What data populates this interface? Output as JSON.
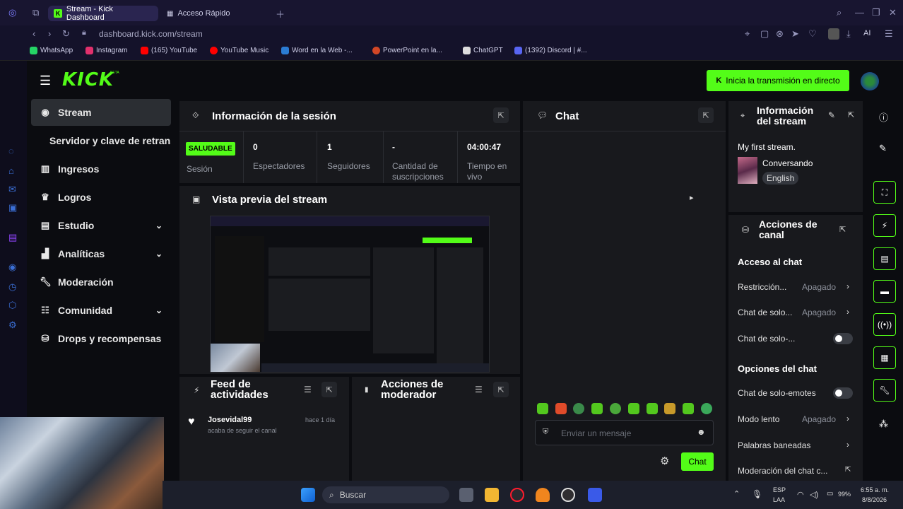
{
  "browser": {
    "tabs": [
      {
        "label": "Stream - Kick Dashboard"
      },
      {
        "label": "Acceso Rápido"
      }
    ],
    "url": "dashboard.kick.com/stream",
    "ai_label": "AI",
    "bookmarks": [
      {
        "label": "WhatsApp",
        "color": "#25d366"
      },
      {
        "label": "Instagram",
        "color": "#e1306c"
      },
      {
        "label": "(165) YouTube",
        "color": "#ff0000"
      },
      {
        "label": "YouTube Music",
        "color": "#ff0000"
      },
      {
        "label": "Word en la Web -...",
        "color": "#2b7cd3"
      },
      {
        "label": "PowerPoint en la...",
        "color": "#d24726"
      },
      {
        "label": "ChatGPT",
        "color": "#dddddd"
      },
      {
        "label": "(1392) Discord | #...",
        "color": "#5865f2"
      }
    ]
  },
  "header": {
    "logo": "KICK",
    "beta": "BETA",
    "go_live": "Inicia la transmisión en directo"
  },
  "sidebar": {
    "items": [
      {
        "label": "Stream",
        "icon": "stream-icon"
      },
      {
        "label": "Servidor y clave de retransn"
      },
      {
        "label": "Ingresos",
        "icon": "revenue-icon"
      },
      {
        "label": "Logros",
        "icon": "trophy-icon"
      },
      {
        "label": "Estudio",
        "icon": "studio-icon"
      },
      {
        "label": "Analíticas",
        "icon": "analytics-icon"
      },
      {
        "label": "Moderación",
        "icon": "wrench-icon"
      },
      {
        "label": "Comunidad",
        "icon": "community-icon"
      },
      {
        "label": "Drops y recompensas",
        "icon": "drops-icon"
      }
    ]
  },
  "session": {
    "title": "Información de la sesión",
    "status": "SALUDABLE",
    "status_label": "Sesión",
    "stats": [
      {
        "value": "0",
        "label": "Espectadores"
      },
      {
        "value": "1",
        "label": "Seguidores"
      },
      {
        "value": "-",
        "label": "Cantidad de suscripciones"
      },
      {
        "value": "04:00:47",
        "label": "Tiempo en vivo"
      }
    ]
  },
  "preview": {
    "title": "Vista previa del stream"
  },
  "activity": {
    "title": "Feed de actividades",
    "item": {
      "user": "Josevidal99",
      "time": "hace 1 día",
      "text": "acaba de seguir el canal"
    }
  },
  "mod_actions": {
    "title": "Acciones de moderador"
  },
  "chat": {
    "title": "Chat",
    "placeholder": "Enviar un mensaje",
    "send": "Chat"
  },
  "stream_info": {
    "title": "Información del stream",
    "stream_title": "My first stream.",
    "category": "Conversando",
    "language": "English"
  },
  "channel_actions": {
    "title": "Acciones de canal",
    "chat_access_heading": "Acceso al chat",
    "chat_access": [
      {
        "label": "Restricción...",
        "value": "Apagado"
      },
      {
        "label": "Chat de solo...",
        "value": "Apagado"
      },
      {
        "label": "Chat de solo-...",
        "toggle": false
      }
    ],
    "chat_options_heading": "Opciones del chat",
    "chat_options": [
      {
        "label": "Chat de solo-emotes",
        "toggle": false
      },
      {
        "label": "Modo lento",
        "value": "Apagado"
      },
      {
        "label": "Palabras baneadas"
      },
      {
        "label": "Moderación del chat c..."
      }
    ]
  },
  "taskbar": {
    "search": "Buscar",
    "lang": "ESP",
    "layout": "LAA",
    "battery": "99%",
    "time": "6:55 a. m.",
    "date": "8/8/2026"
  },
  "colors": {
    "accent": "#53fc18",
    "panel": "#18191d",
    "bg": "#0b0c10"
  }
}
